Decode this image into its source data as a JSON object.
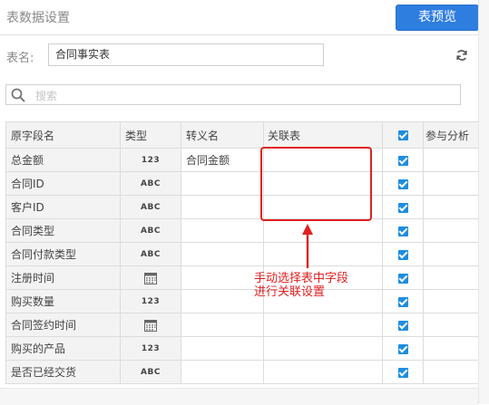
{
  "header": {
    "title": "表数据设置",
    "preview_label": "表预览"
  },
  "name_field": {
    "label": "表名:",
    "value": "合同事实表"
  },
  "search": {
    "placeholder": "搜索"
  },
  "columns": {
    "name": "原字段名",
    "type": "类型",
    "alias": "转义名",
    "relation": "关联表",
    "participate": "参与分析"
  },
  "rows": [
    {
      "name": "总金额",
      "type": "123",
      "icon": "",
      "alias": "合同金额"
    },
    {
      "name": "合同ID",
      "type": "ABC",
      "icon": "",
      "alias": ""
    },
    {
      "name": "客户ID",
      "type": "ABC",
      "icon": "",
      "alias": ""
    },
    {
      "name": "合同类型",
      "type": "ABC",
      "icon": "",
      "alias": ""
    },
    {
      "name": "合同付款类型",
      "type": "ABC",
      "icon": "",
      "alias": ""
    },
    {
      "name": "注册时间",
      "type": "",
      "icon": "calendar-icon",
      "alias": ""
    },
    {
      "name": "购买数量",
      "type": "123",
      "icon": "",
      "alias": ""
    },
    {
      "name": "合同签约时间",
      "type": "",
      "icon": "calendar-icon",
      "alias": ""
    },
    {
      "name": "购买的产品",
      "type": "123",
      "icon": "",
      "alias": ""
    },
    {
      "name": "是否已经交货",
      "type": "ABC",
      "icon": "",
      "alias": ""
    }
  ],
  "annotation": {
    "line1": "手动选择表中字段",
    "line2": "进行关联设置"
  },
  "colors": {
    "accent": "#2e7ee0",
    "checkbox": "#1e8de0",
    "annotation": "#e02020"
  }
}
